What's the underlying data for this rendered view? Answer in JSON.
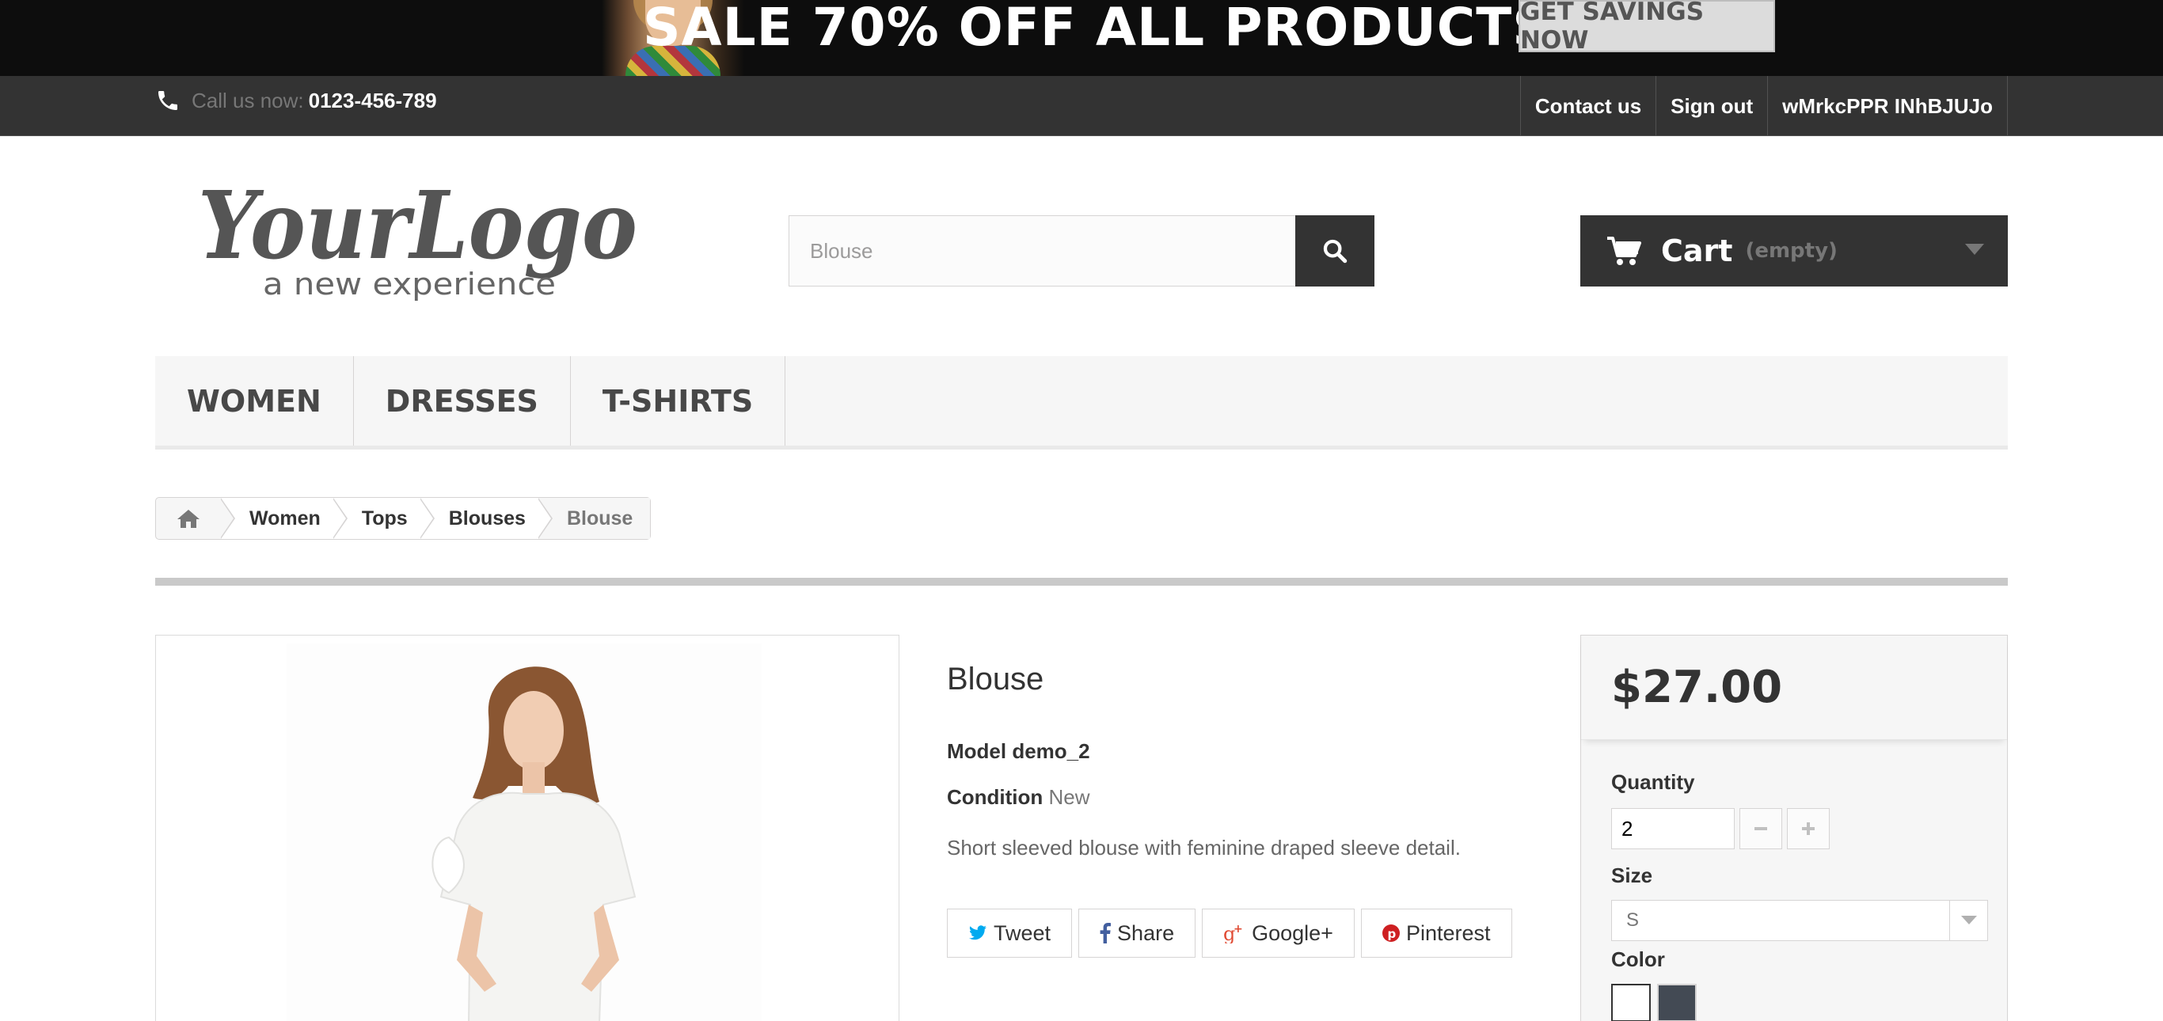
{
  "promo": {
    "text": "SALE 70% OFF ALL PRODUCTS",
    "button_label": "GET SAVINGS NOW"
  },
  "topbar": {
    "phone_prefix": "Call us now:",
    "phone_number": "0123-456-789",
    "links": [
      "Contact us",
      "Sign out",
      "wMrkcPPR INhBJUJo"
    ]
  },
  "header": {
    "logo_main": "YourLogo",
    "logo_tagline": "a new experience",
    "search_value": "Blouse",
    "cart_label": "Cart",
    "cart_status": "(empty)"
  },
  "menu": {
    "items": [
      "WOMEN",
      "DRESSES",
      "T-SHIRTS"
    ]
  },
  "breadcrumb": {
    "items": [
      "Women",
      "Tops",
      "Blouses"
    ],
    "current": "Blouse"
  },
  "product": {
    "title": "Blouse",
    "model_label": "Model",
    "model_value": "demo_2",
    "condition_label": "Condition",
    "condition_value": "New",
    "description": "Short sleeved blouse with feminine draped sleeve detail.",
    "social": [
      "Tweet",
      "Share",
      "Google+",
      "Pinterest"
    ]
  },
  "buybox": {
    "price": "$27.00",
    "quantity_label": "Quantity",
    "quantity_value": "2",
    "size_label": "Size",
    "size_value": "S",
    "color_label": "Color",
    "colors": [
      "#ffffff",
      "#434a54"
    ]
  },
  "colors": {
    "dark": "#333333",
    "menu_bg": "#f6f6f6",
    "twitter": "#00aaf0",
    "facebook": "#435f9f",
    "google": "#e04b34",
    "pinterest": "#ce1f21"
  }
}
